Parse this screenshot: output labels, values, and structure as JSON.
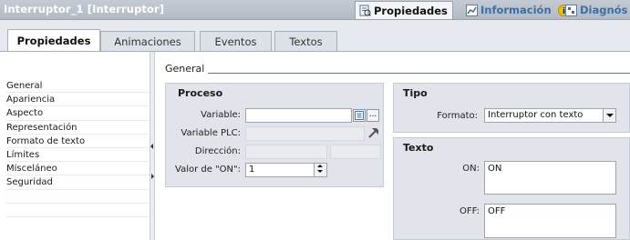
{
  "window": {
    "title": "Interruptor_1 [Interruptor]",
    "tabs": [
      {
        "label": "Propiedades",
        "icon": "properties-icon",
        "active": true
      },
      {
        "label": "Información",
        "icon": "info-chart-icon",
        "active": false
      },
      {
        "label": "Diagnós",
        "icon": "diagnostics-icon",
        "active": false
      }
    ]
  },
  "subtabs": [
    {
      "label": "Propiedades",
      "active": true
    },
    {
      "label": "Animaciones",
      "active": false
    },
    {
      "label": "Eventos",
      "active": false
    },
    {
      "label": "Textos",
      "active": false
    }
  ],
  "nav": {
    "items": [
      "General",
      "Apariencia",
      "Aspecto",
      "Representación",
      "Formato de texto",
      "Límites",
      "Misceláneo",
      "Seguridad"
    ],
    "selected": "General"
  },
  "section_heading": "General",
  "proceso": {
    "title": "Proceso",
    "variable_label": "Variable:",
    "variable_value": "",
    "variable_plc_label": "Variable PLC:",
    "direccion_label": "Dirección:",
    "valor_on_label": "Valor de \"ON\":",
    "valor_on_value": "1",
    "browse_button": "..."
  },
  "tipo": {
    "title": "Tipo",
    "formato_label": "Formato:",
    "formato_value": "Interruptor con texto"
  },
  "texto": {
    "title": "Texto",
    "on_label": "ON:",
    "on_value": "ON",
    "off_label": "OFF:",
    "off_value": "OFF"
  },
  "colors": {
    "titlebar": "#b3bac4",
    "panel": "#e1e4ea",
    "accent_tab": "#3a6fa8",
    "info_badge": "#f2c200"
  }
}
